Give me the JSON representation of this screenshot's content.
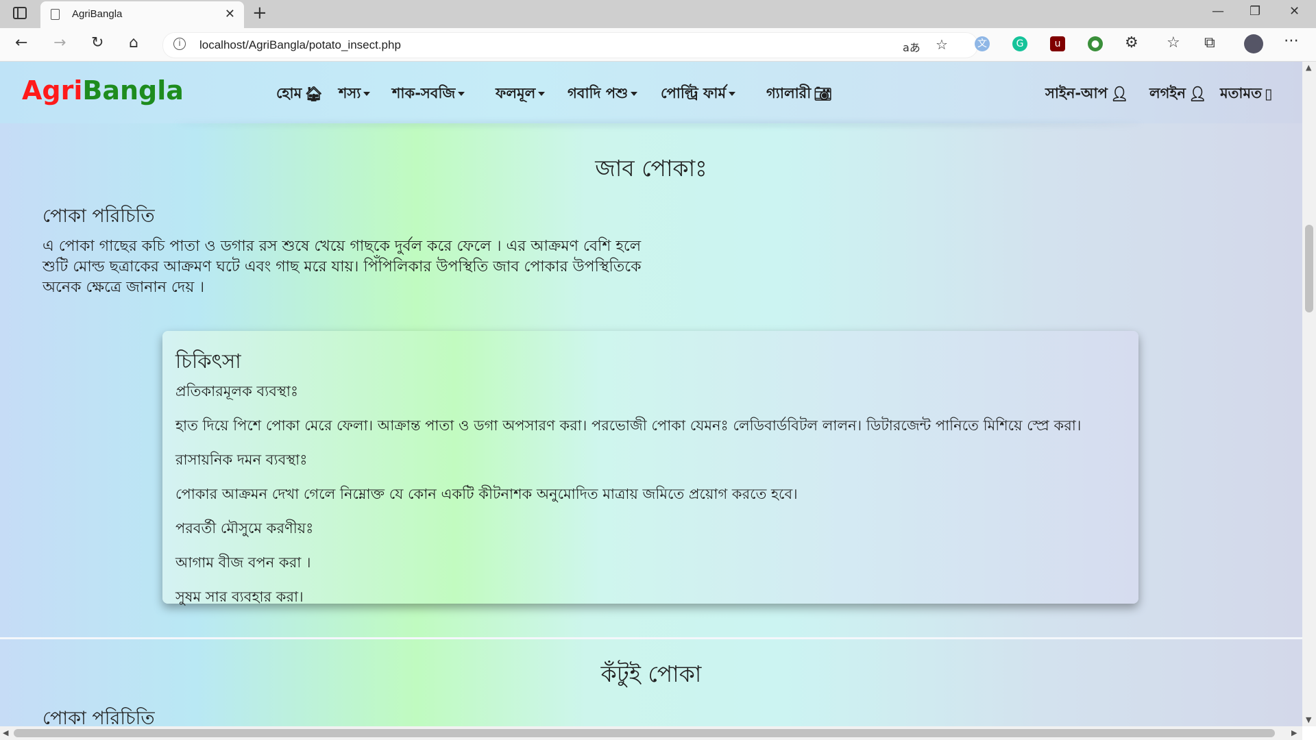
{
  "browser": {
    "tab_title": "AgriBangla",
    "url": "localhost/AgriBangla/potato_insect.php",
    "read_aloud": "aあ"
  },
  "nav": {
    "brand_part1": "Agri",
    "brand_part2": "Bangla",
    "home": "হোম",
    "crops": "শস্য",
    "vegetables": "শাক-সবজি",
    "fruits": "ফলমূল",
    "livestock": "গবাদি পশু",
    "poultry": "পোল্ট্রি ফার্ম",
    "gallery": "গ্যালারী",
    "signup": "সাইন-আপ",
    "login": "লগইন",
    "feedback": "মতামত"
  },
  "section1": {
    "title": "জাব পোকাঃ",
    "intro_heading": "পোকা পরিচিতি",
    "intro_lines": [
      "এ পোকা গাছের কচি পাতা ও ডগার রস শুষে খেয়ে গাছকে দুর্বল করে ফেলে । এর আক্রমণ বেশি হলে",
      "শুটি মোল্ড ছত্রাকের আক্রমণ ঘটে এবং গাছ মরে যায়। পিঁপিলিকার উপস্থিতি জাব পোকার উপস্থিতিকে",
      "অনেক ক্ষেত্রে জানান দেয় ।"
    ],
    "treatment": {
      "heading": "চিকিৎসা",
      "preventive_label": "প্রতিকারমূলক ব্যবস্থাঃ",
      "preventive_text": "হাত দিয়ে পিশে পোকা মেরে ফেলা। আক্রান্ত পাতা ও ডগা অপসারণ করা। পরভোজী পোকা যেমনঃ লেডিবার্ডবিটল লালন। ডিটারজেন্ট পানিতে মিশিয়ে স্প্রে করা।",
      "chemical_label": "রাসায়নিক দমন ব্যবস্থাঃ",
      "chemical_text": "পোকার আক্রমন দেখা গেলে নিম্নোক্ত যে কোন একটি কীটনাশক অনুমোদিত মাত্রায় জমিতে প্রয়োগ করতে হবে।",
      "next_season_label": "পরবর্তী মৌসুমে করণীয়ঃ",
      "next_season_1": "আগাম বীজ বপন করা ।",
      "next_season_2": "সুষম সার ব্যবহার করা।"
    }
  },
  "section2": {
    "title": "কঁটুই পোকা",
    "intro_heading": "পোকা পরিচিতি"
  }
}
